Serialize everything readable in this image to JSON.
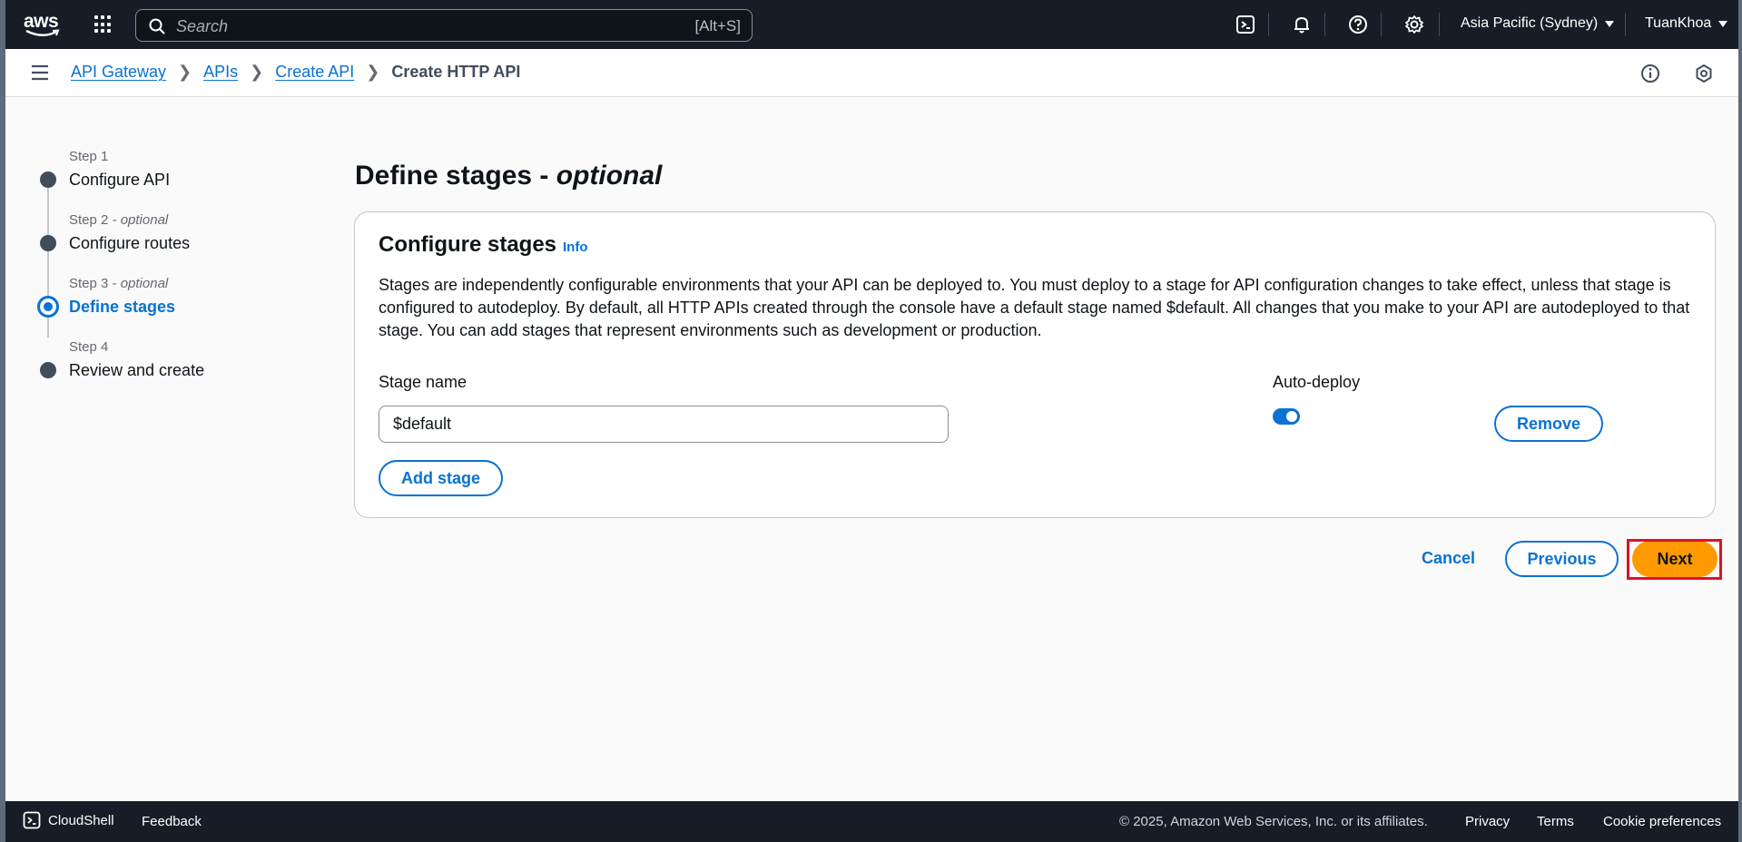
{
  "topnav": {
    "logo_text": "aws",
    "search_placeholder": "Search",
    "search_shortcut": "[Alt+S]",
    "region": "Asia Pacific (Sydney)",
    "user": "TuanKhoa"
  },
  "breadcrumb": {
    "items": [
      "API Gateway",
      "APIs",
      "Create API"
    ],
    "current": "Create HTTP API"
  },
  "steps": [
    {
      "label": "Step 1",
      "optional": "",
      "name": "Configure API"
    },
    {
      "label": "Step 2",
      "optional": "- optional",
      "name": "Configure routes"
    },
    {
      "label": "Step 3",
      "optional": "- optional",
      "name": "Define stages"
    },
    {
      "label": "Step 4",
      "optional": "",
      "name": "Review and create"
    }
  ],
  "page": {
    "title": "Define stages -",
    "title_optional": "optional"
  },
  "card": {
    "title": "Configure stages",
    "info": "Info",
    "description": "Stages are independently configurable environments that your API can be deployed to. You must deploy to a stage for API configuration changes to take effect, unless that stage is configured to autodeploy. By default, all HTTP APIs created through the console have a default stage named $default. All changes that you make to your API are autodeployed to that stage. You can add stages that represent environments such as development or production.",
    "stage_name_label": "Stage name",
    "stage_name_value": "$default",
    "auto_deploy_label": "Auto-deploy",
    "auto_deploy_on": true,
    "remove_label": "Remove",
    "add_stage_label": "Add stage"
  },
  "actions": {
    "cancel": "Cancel",
    "previous": "Previous",
    "next": "Next"
  },
  "footer": {
    "cloudshell": "CloudShell",
    "feedback": "Feedback",
    "copyright": "© 2025, Amazon Web Services, Inc. or its affiliates.",
    "privacy": "Privacy",
    "terms": "Terms",
    "cookies": "Cookie preferences"
  },
  "colors": {
    "nav_bg": "#161d26",
    "link": "#0972d3",
    "primary": "#ff9900",
    "highlight": "#e0102a"
  }
}
